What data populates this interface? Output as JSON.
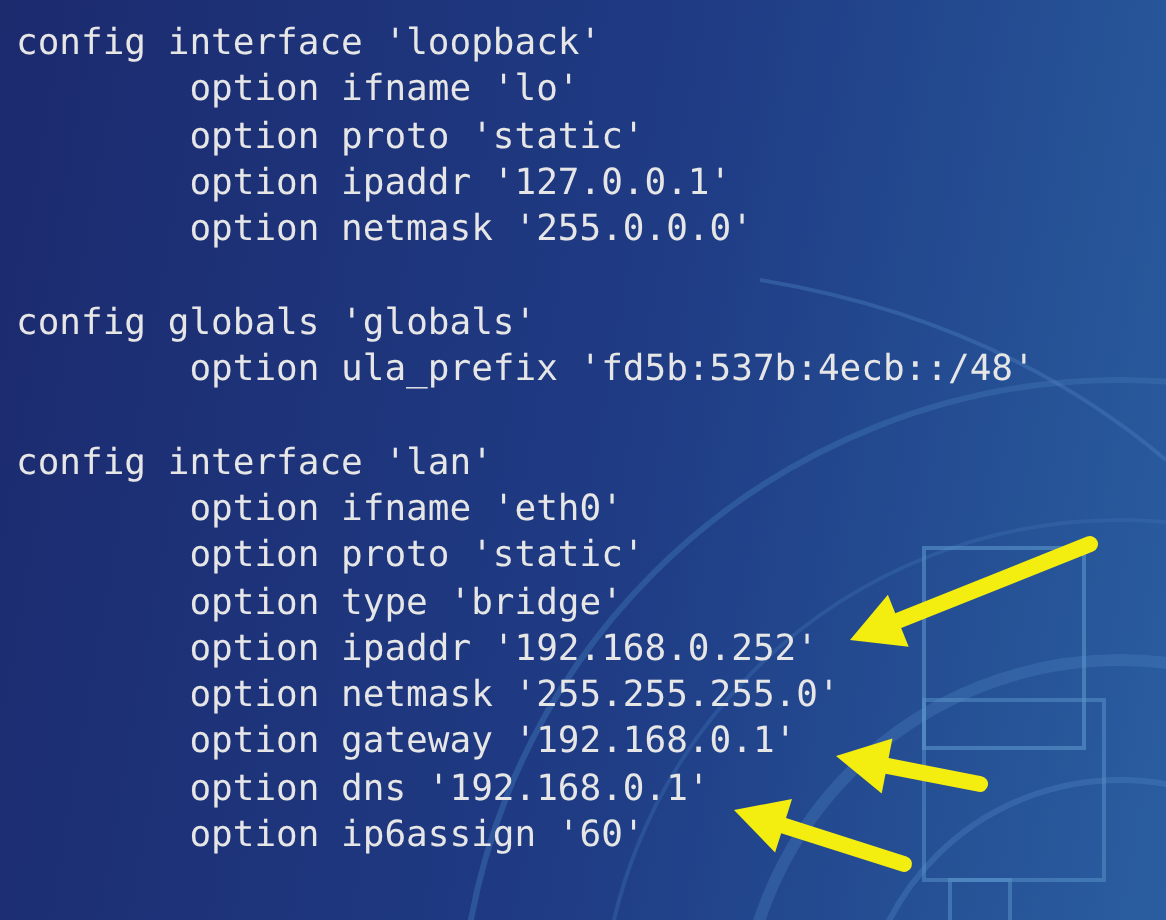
{
  "terminal": {
    "blocks": [
      {
        "header": "config interface 'loopback'",
        "options": [
          "option ifname 'lo'",
          "option proto 'static'",
          "option ipaddr '127.0.0.1'",
          "option netmask '255.0.0.0'"
        ]
      },
      {
        "header": "config globals 'globals'",
        "options": [
          "option ula_prefix 'fd5b:537b:4ecb::/48'"
        ]
      },
      {
        "header": "config interface 'lan'",
        "options": [
          "option ifname 'eth0'",
          "option proto 'static'",
          "option type 'bridge'",
          "option ipaddr '192.168.0.252'",
          "option netmask '255.255.255.0'",
          "option gateway '192.168.0.1'",
          "option dns '192.168.0.1'",
          "option ip6assign '60'"
        ]
      }
    ]
  }
}
